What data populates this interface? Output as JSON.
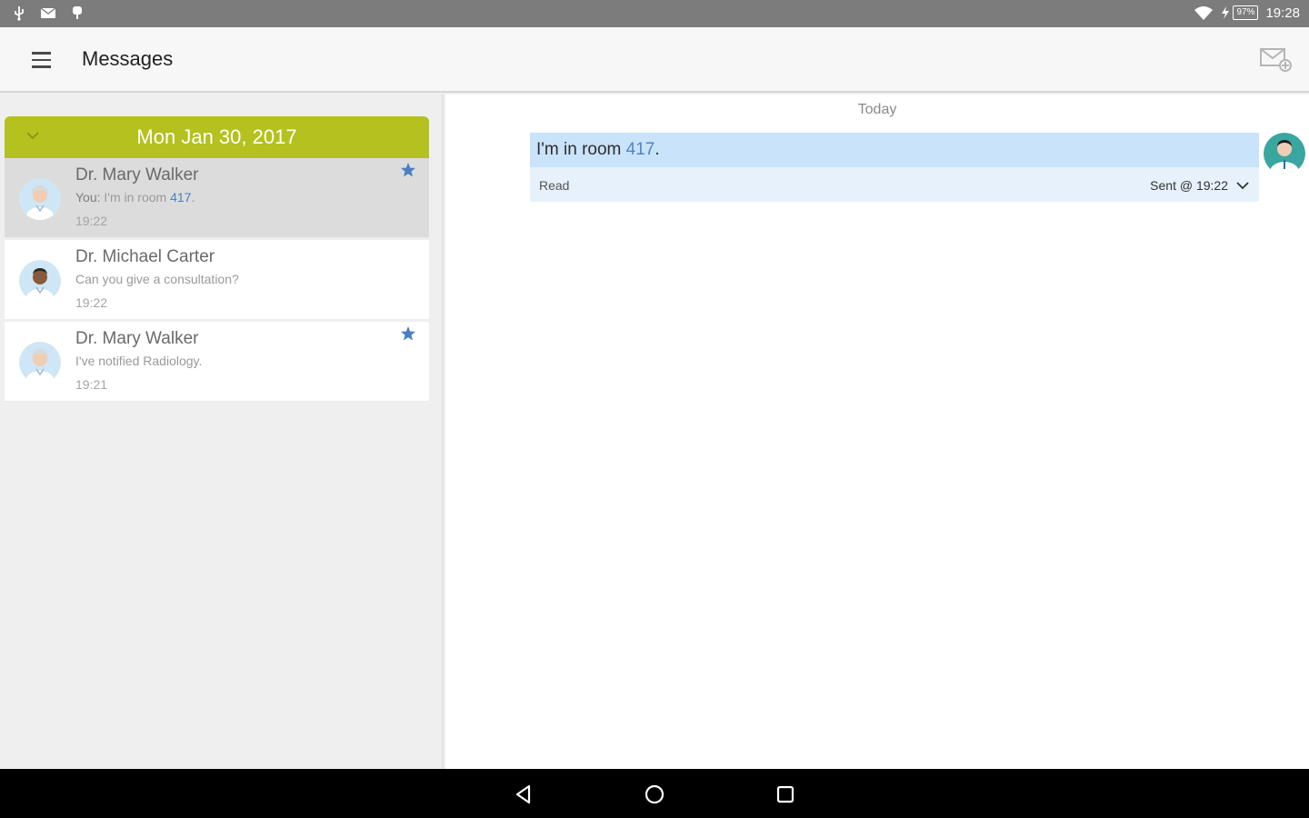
{
  "status_bar": {
    "battery": "97%",
    "time": "19:28"
  },
  "app_bar": {
    "title": "Messages"
  },
  "conversation_list": {
    "date_header": "Mon Jan 30, 2017",
    "items": [
      {
        "name": "Dr. Mary Walker",
        "preview_prefix": "You:",
        "preview_text": " I'm in room ",
        "preview_highlight": "417",
        "preview_suffix": ".",
        "time": "19:22",
        "starred": true
      },
      {
        "name": "Dr. Michael Carter",
        "preview_text": "Can you give a consultation?",
        "time": "19:22",
        "starred": false
      },
      {
        "name": "Dr. Mary Walker",
        "preview_text": "I've notified Radiology.",
        "time": "19:21",
        "starred": true
      }
    ]
  },
  "thread": {
    "day_label": "Today",
    "message": {
      "text": "I'm in room ",
      "highlight": "417",
      "suffix": ".",
      "status": "Read",
      "sent": "Sent @ 19:22"
    }
  },
  "colors": {
    "accent_green": "#b4c11f",
    "star_blue": "#4a7fc0",
    "bubble_light": "#e6f1fb",
    "bubble_text_bg": "#c9e3fa"
  }
}
